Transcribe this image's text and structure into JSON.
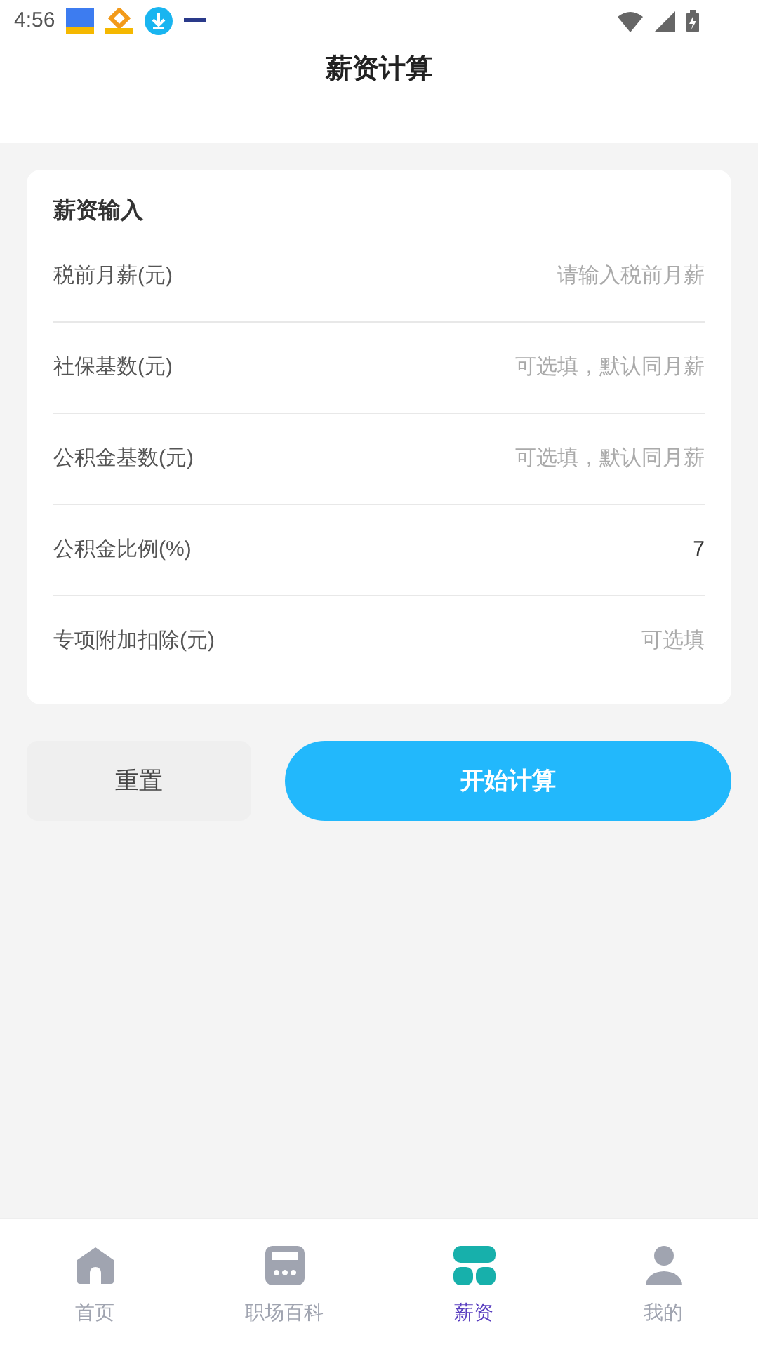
{
  "status_bar": {
    "time": "4:56"
  },
  "header": {
    "title": "薪资计算"
  },
  "form": {
    "title": "薪资输入",
    "fields": [
      {
        "label": "税前月薪(元)",
        "placeholder": "请输入税前月薪"
      },
      {
        "label": "社保基数(元)",
        "placeholder": "可选填，默认同月薪"
      },
      {
        "label": "公积金基数(元)",
        "placeholder": "可选填，默认同月薪"
      },
      {
        "label": "公积金比例(%)",
        "value": "7"
      },
      {
        "label": "专项附加扣除(元)",
        "placeholder": "可选填"
      }
    ]
  },
  "buttons": [
    {
      "label": "重置",
      "kind": "secondary"
    },
    {
      "label": "开始计算",
      "kind": "primary"
    }
  ],
  "tab_bar": [
    {
      "label": "首页",
      "kind": "home",
      "selected": false
    },
    {
      "label": "职场百科",
      "kind": "calculator",
      "selected": false
    },
    {
      "label": "薪资",
      "kind": "grid",
      "selected": true
    },
    {
      "label": "我的",
      "kind": "user",
      "selected": false
    }
  ]
}
